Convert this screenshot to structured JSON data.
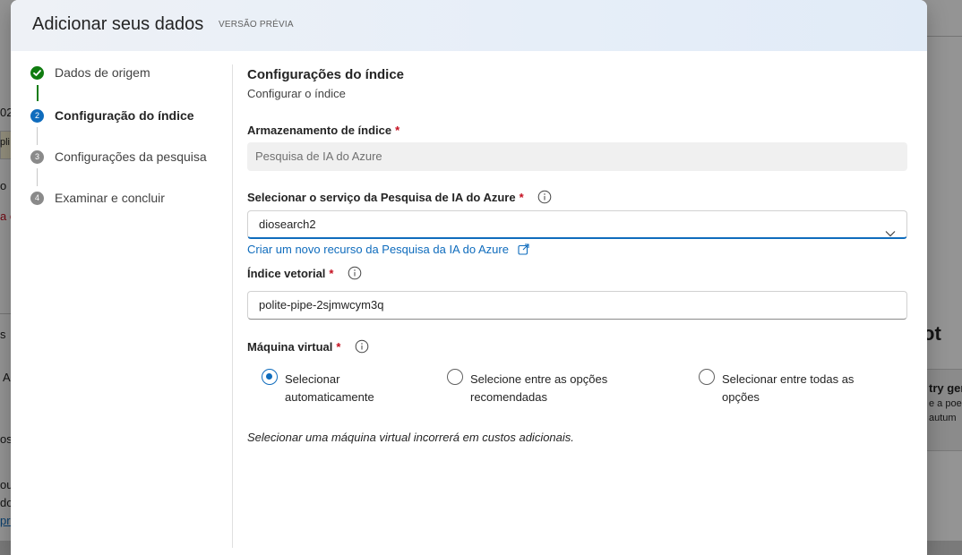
{
  "background": {
    "fragments": [
      "02",
      "pli",
      "o",
      "a e",
      "A",
      "os",
      "ou",
      "do",
      "pro",
      "ot",
      "try ger",
      "e a poe",
      "autum",
      "s"
    ]
  },
  "dialog": {
    "title": "Adicionar seus dados",
    "badge": "VERSÃO PRÉVIA"
  },
  "steps": [
    {
      "label": "Dados de origem",
      "state": "done",
      "number": ""
    },
    {
      "label": "Configuração do índice",
      "state": "active",
      "number": "2"
    },
    {
      "label": "Configurações da pesquisa",
      "state": "pending",
      "number": "3"
    },
    {
      "label": "Examinar e concluir",
      "state": "pending",
      "number": "4"
    }
  ],
  "main": {
    "title": "Configurações do índice",
    "subtitle": "Configurar o índice",
    "storage": {
      "label": "Armazenamento de índice",
      "required_mark": "*",
      "value": "Pesquisa de IA do Azure"
    },
    "service": {
      "label": "Selecionar o serviço da Pesquisa de IA do Azure",
      "required_mark": "*",
      "selected": "diosearch2",
      "create_link": "Criar um novo recurso da Pesquisa da IA do Azure"
    },
    "vector_index": {
      "label": "Índice vetorial",
      "required_mark": "*",
      "value": "polite-pipe-2sjmwcym3q"
    },
    "vm": {
      "label": "Máquina virtual",
      "required_mark": "*",
      "options": [
        {
          "label": "Selecionar automaticamente",
          "checked": true
        },
        {
          "label": "Selecione entre as opções recomendadas",
          "checked": false
        },
        {
          "label": "Selecionar entre todas as opções",
          "checked": false
        }
      ],
      "note": "Selecionar uma máquina virtual incorrerá em custos adicionais."
    }
  },
  "colors": {
    "accent": "#0f6cbd",
    "success": "#107c10",
    "required": "#c50f1f"
  }
}
